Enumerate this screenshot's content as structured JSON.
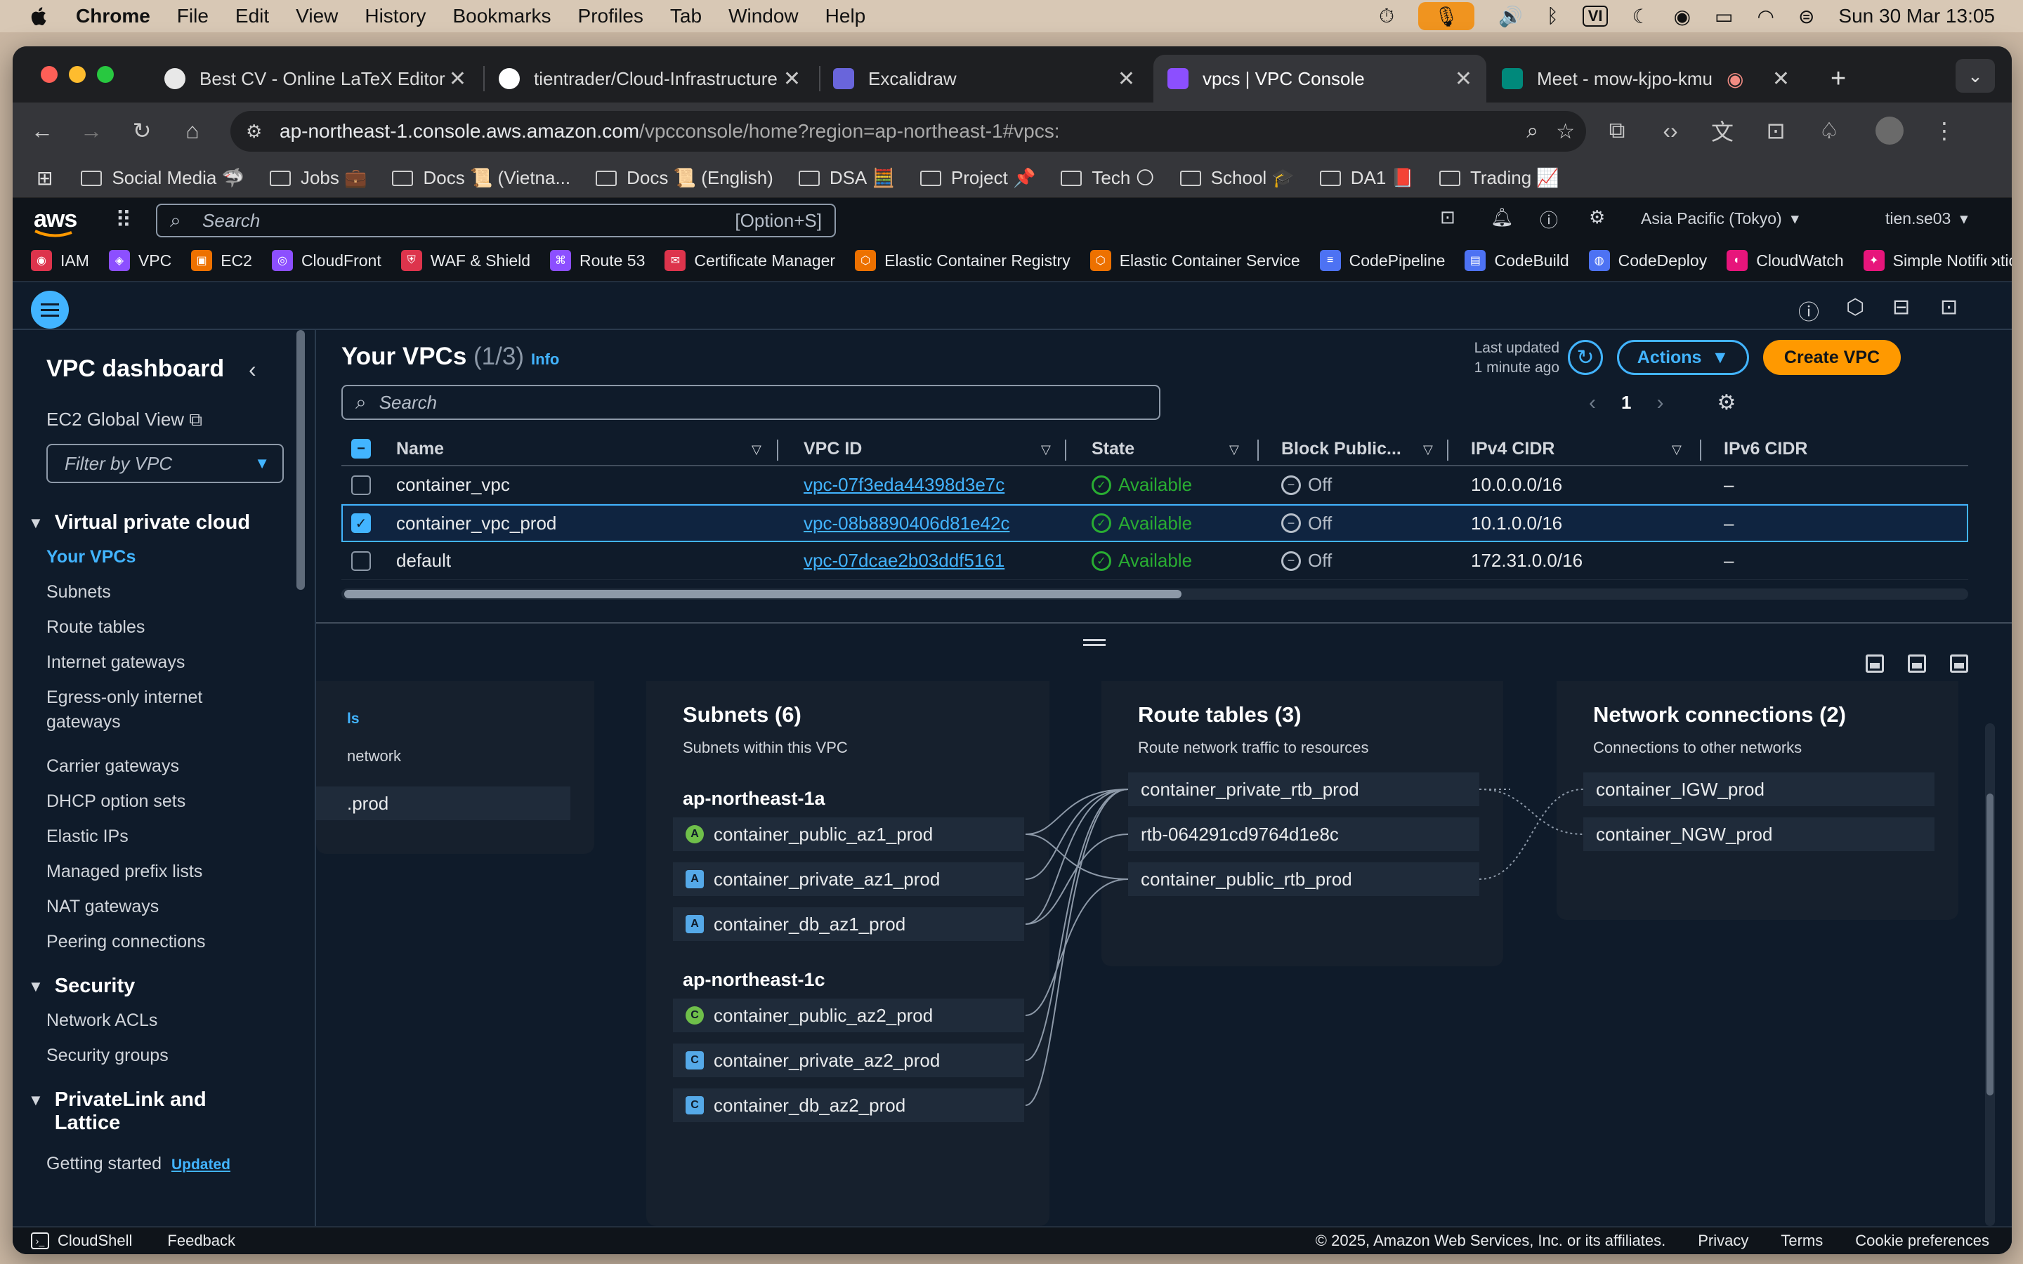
{
  "menubar": {
    "app": "Chrome",
    "items": [
      "File",
      "Edit",
      "View",
      "History",
      "Bookmarks",
      "Profiles",
      "Tab",
      "Window",
      "Help"
    ],
    "input_indicator": "VI",
    "datetime": "Sun 30 Mar  13:05"
  },
  "tabs": [
    {
      "title": "Best CV - Online LaTeX Editor",
      "color": "#e8e8e8"
    },
    {
      "title": "tientrader/Cloud-Infrastructure",
      "color": "#ffffff"
    },
    {
      "title": "Excalidraw",
      "color": "#6965db"
    },
    {
      "title": "vpcs | VPC Console",
      "color": "#8c4fff"
    },
    {
      "title": "Meet - mow-kjpo-kmu",
      "color": "#00897b"
    }
  ],
  "address": {
    "host": "ap-northeast-1.console.aws.amazon.com",
    "path": "/vpcconsole/home?region=ap-northeast-1#vpcs:"
  },
  "bookmarks": [
    {
      "label": "Social Media",
      "emoji": "🦈"
    },
    {
      "label": "Jobs",
      "emoji": "💼"
    },
    {
      "label": "Docs",
      "emoji": "📜 (Vietna..."
    },
    {
      "label": "Docs",
      "emoji": "📜 (English)"
    },
    {
      "label": "DSA",
      "emoji": "🧮"
    },
    {
      "label": "Project",
      "emoji": "📌"
    },
    {
      "label": "Tech",
      "emoji": "🌕"
    },
    {
      "label": "School",
      "emoji": "🎓"
    },
    {
      "label": "DA1",
      "emoji": "📕"
    },
    {
      "label": "Trading",
      "emoji": "📈"
    }
  ],
  "aws": {
    "logo": "aws",
    "search_placeholder": "Search",
    "search_shortcut": "[Option+S]",
    "region": "Asia Pacific (Tokyo)",
    "user": "tien.se03",
    "favorites": [
      {
        "label": "IAM",
        "color": "#dd344c"
      },
      {
        "label": "VPC",
        "color": "#8c4fff"
      },
      {
        "label": "EC2",
        "color": "#ed7100"
      },
      {
        "label": "CloudFront",
        "color": "#8c4fff"
      },
      {
        "label": "WAF & Shield",
        "color": "#dd344c"
      },
      {
        "label": "Route 53",
        "color": "#8c4fff"
      },
      {
        "label": "Certificate Manager",
        "color": "#dd344c"
      },
      {
        "label": "Elastic Container Registry",
        "color": "#ed7100"
      },
      {
        "label": "Elastic Container Service",
        "color": "#ed7100"
      },
      {
        "label": "CodePipeline",
        "color": "#4d72f3"
      },
      {
        "label": "CodeBuild",
        "color": "#4d72f3"
      },
      {
        "label": "CodeDeploy",
        "color": "#4d72f3"
      },
      {
        "label": "CloudWatch",
        "color": "#e7157b"
      },
      {
        "label": "Simple Notificatio",
        "color": "#e7157b"
      }
    ]
  },
  "sidebar": {
    "title": "VPC dashboard",
    "global_view": "EC2 Global View",
    "filter_placeholder": "Filter by VPC",
    "sections": [
      {
        "title": "Virtual private cloud",
        "items": [
          "Your VPCs",
          "Subnets",
          "Route tables",
          "Internet gateways",
          "Egress-only internet gateways",
          "Carrier gateways",
          "DHCP option sets",
          "Elastic IPs",
          "Managed prefix lists",
          "NAT gateways",
          "Peering connections"
        ]
      },
      {
        "title": "Security",
        "items": [
          "Network ACLs",
          "Security groups"
        ]
      },
      {
        "title": "PrivateLink and Lattice",
        "items": [
          "Getting started"
        ]
      }
    ],
    "updated_badge": "Updated"
  },
  "main": {
    "title": "Your VPCs",
    "count": "(1/3)",
    "info": "Info",
    "last_updated_line1": "Last updated",
    "last_updated_line2": "1 minute ago",
    "actions": "Actions",
    "create": "Create VPC",
    "search_placeholder": "Search",
    "page": "1",
    "columns": [
      "Name",
      "VPC ID",
      "State",
      "Block Public...",
      "IPv4 CIDR",
      "IPv6 CIDR"
    ],
    "rows": [
      {
        "name": "container_vpc",
        "id": "vpc-07f3eda44398d3e7c",
        "state": "Available",
        "block": "Off",
        "ipv4": "10.0.0.0/16",
        "ipv6": "–",
        "selected": false
      },
      {
        "name": "container_vpc_prod",
        "id": "vpc-08b8890406d81e42c",
        "state": "Available",
        "block": "Off",
        "ipv4": "10.1.0.0/16",
        "ipv6": "–",
        "selected": true
      },
      {
        "name": "default",
        "id": "vpc-07dcae2b03ddf5161",
        "state": "Available",
        "block": "Off",
        "ipv4": "172.31.0.0/16",
        "ipv6": "–",
        "selected": false
      }
    ]
  },
  "map": {
    "vpc_partial": {
      "title": "ls",
      "sub": "network",
      "node": ".prod"
    },
    "subnets": {
      "title": "Subnets (6)",
      "sub": "Subnets within this VPC",
      "az1": "ap-northeast-1a",
      "az1_nodes": [
        {
          "badge": "A",
          "label": "container_public_az1_prod"
        },
        {
          "badge": "A",
          "label": "container_private_az1_prod"
        },
        {
          "badge": "A",
          "label": "container_db_az1_prod"
        }
      ],
      "az2": "ap-northeast-1c",
      "az2_nodes": [
        {
          "badge": "C",
          "label": "container_public_az2_prod"
        },
        {
          "badge": "C",
          "label": "container_private_az2_prod"
        },
        {
          "badge": "C",
          "label": "container_db_az2_prod"
        }
      ]
    },
    "route_tables": {
      "title": "Route tables (3)",
      "sub": "Route network traffic to resources",
      "nodes": [
        "container_private_rtb_prod",
        "rtb-064291cd9764d1e8c",
        "container_public_rtb_prod"
      ]
    },
    "network": {
      "title": "Network connections (2)",
      "sub": "Connections to other networks",
      "nodes": [
        "container_IGW_prod",
        "container_NGW_prod"
      ]
    }
  },
  "footer": {
    "cloudshell": "CloudShell",
    "feedback": "Feedback",
    "copyright": "© 2025, Amazon Web Services, Inc. or its affiliates.",
    "privacy": "Privacy",
    "terms": "Terms",
    "cookies": "Cookie preferences"
  }
}
